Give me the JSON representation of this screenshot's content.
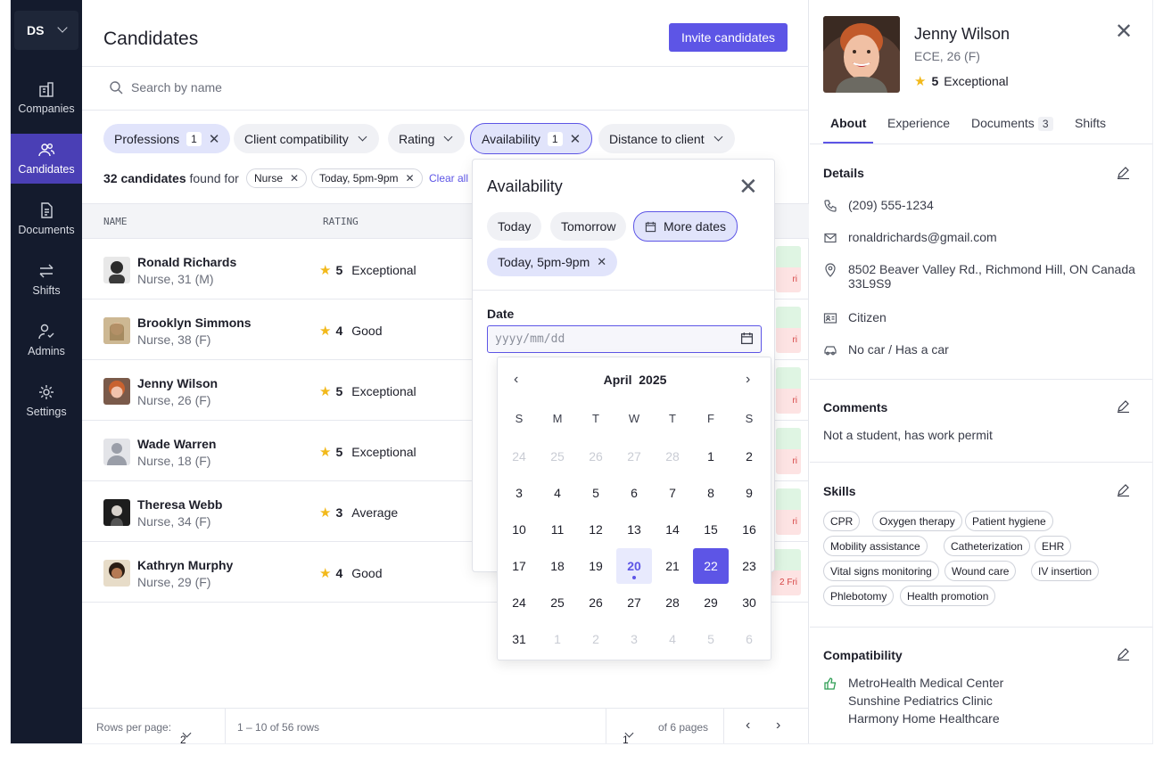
{
  "nav": {
    "org": "DS",
    "items": [
      {
        "label": "Companies"
      },
      {
        "label": "Candidates"
      },
      {
        "label": "Documents"
      },
      {
        "label": "Shifts"
      },
      {
        "label": "Admins"
      },
      {
        "label": "Settings"
      }
    ]
  },
  "header": {
    "title": "Candidates",
    "invite": "Invite candidates"
  },
  "search": {
    "placeholder": "Search by name"
  },
  "filters": [
    {
      "label": "Professions",
      "count": "1"
    },
    {
      "label": "Client compatibility"
    },
    {
      "label": "Rating"
    },
    {
      "label": "Availability",
      "count": "1"
    },
    {
      "label": "Distance to client"
    }
  ],
  "results": {
    "count": "32 candidates",
    "suffix": "found for",
    "tags": [
      "Nurse",
      "Today, 5pm-9pm"
    ],
    "clear": "Clear all"
  },
  "table": {
    "headers": [
      "NAME",
      "RATING"
    ],
    "rows": [
      {
        "name": "Ronald Richards",
        "sub": "Nurse, 31 (M)",
        "rating": "5",
        "rating_label": "Exceptional",
        "avail": "ri"
      },
      {
        "name": "Brooklyn Simmons",
        "sub": "Nurse, 38 (F)",
        "rating": "4",
        "rating_label": "Good",
        "avail": "ri"
      },
      {
        "name": "Jenny Wilson",
        "sub": "Nurse, 26 (F)",
        "rating": "5",
        "rating_label": "Exceptional",
        "avail": "ri"
      },
      {
        "name": "Wade Warren",
        "sub": "Nurse, 18 (F)",
        "rating": "5",
        "rating_label": "Exceptional",
        "avail": "ri"
      },
      {
        "name": "Theresa Webb",
        "sub": "Nurse, 34 (F)",
        "rating": "3",
        "rating_label": "Average",
        "avail": "ri"
      },
      {
        "name": "Kathryn Murphy",
        "sub": "Nurse, 29 (F)",
        "rating": "4",
        "rating_label": "Good",
        "avail": "2 Fri"
      }
    ]
  },
  "footer": {
    "rows_label": "Rows per page:",
    "rows_value": "2",
    "range": "1 – 10 of 56 rows",
    "page": "1",
    "pages": "of 6 pages"
  },
  "availability": {
    "title": "Availability",
    "quick": [
      "Today",
      "Tomorrow",
      "More dates"
    ],
    "selected": "Today, 5pm-9pm",
    "date_label": "Date",
    "date_placeholder": "yyyy/mm/dd",
    "month": "April",
    "year": "2025",
    "dow": [
      "S",
      "M",
      "T",
      "W",
      "T",
      "F",
      "S"
    ],
    "weeks": [
      [
        "24",
        "25",
        "26",
        "27",
        "28",
        "1",
        "2"
      ],
      [
        "3",
        "4",
        "5",
        "6",
        "7",
        "8",
        "9"
      ],
      [
        "10",
        "11",
        "12",
        "13",
        "14",
        "15",
        "16"
      ],
      [
        "17",
        "18",
        "19",
        "20",
        "21",
        "22",
        "23"
      ],
      [
        "24",
        "25",
        "26",
        "27",
        "28",
        "29",
        "30"
      ],
      [
        "31",
        "1",
        "2",
        "3",
        "4",
        "5",
        "6"
      ]
    ],
    "today": "20",
    "selected_day": "22"
  },
  "profile": {
    "name": "Jenny Wilson",
    "sub": "ECE, 26 (F)",
    "rating": "5",
    "rating_label": "Exceptional",
    "tabs": [
      {
        "label": "About"
      },
      {
        "label": "Experience"
      },
      {
        "label": "Documents",
        "count": "3"
      },
      {
        "label": "Shifts"
      }
    ],
    "details_title": "Details",
    "phone": "(209) 555-1234",
    "email": "ronaldrichards@gmail.com",
    "address": "8502 Beaver Valley Rd., Richmond Hill, ON Canada",
    "postal": "33L9S9",
    "status": "Citizen",
    "car": "No car / Has a car",
    "comments_title": "Comments",
    "comment": "Not a student, has work permit",
    "skills_title": "Skills",
    "skills": [
      "CPR",
      "Oxygen therapy",
      "Patient hygiene",
      "Mobility assistance",
      "Catheterization",
      "EHR",
      "Vital signs monitoring",
      "Wound care",
      "IV insertion",
      "Phlebotomy",
      "Health promotion"
    ],
    "compat_title": "Compatibility",
    "compat": [
      "MetroHealth Medical Center",
      "Sunshine Pediatrics Clinic",
      "Harmony Home Healthcare"
    ]
  },
  "colors": {
    "accent": "#5d55e6",
    "nav_bg": "#141b2d",
    "nav_active": "#4a3fb5",
    "star": "#f2b91b"
  }
}
